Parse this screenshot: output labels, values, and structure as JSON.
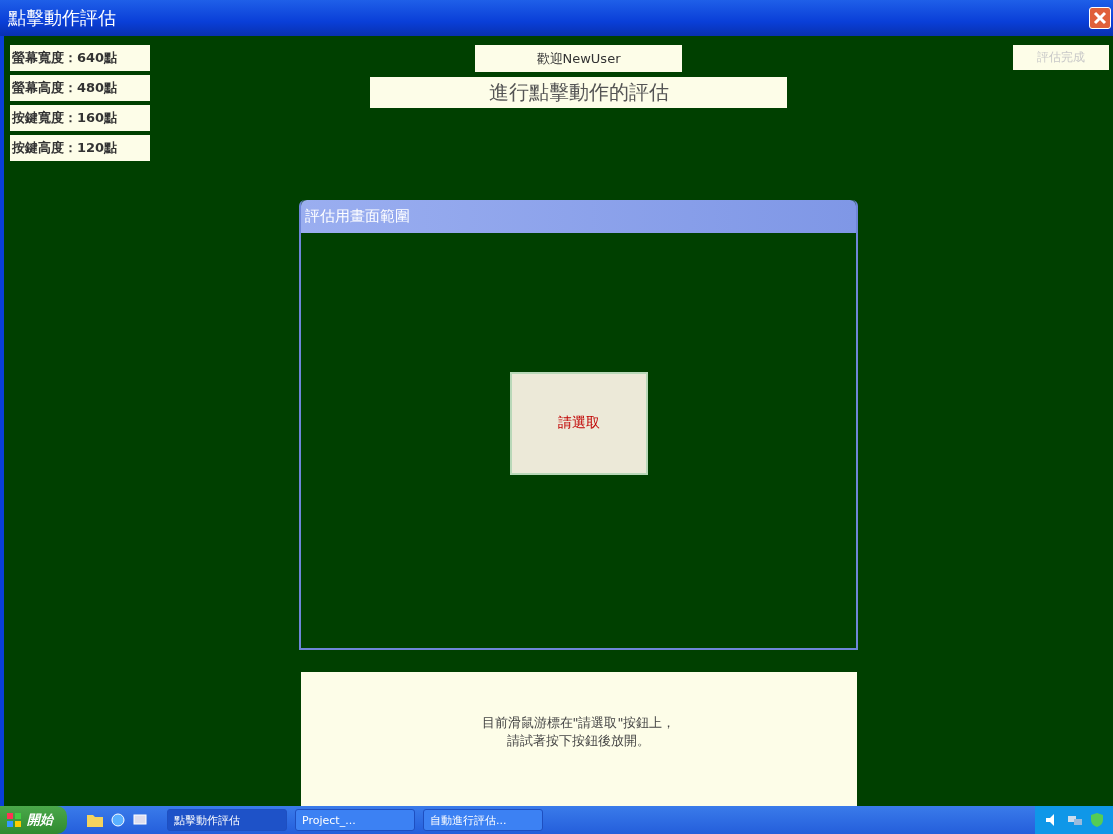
{
  "window": {
    "title": "點擊動作評估"
  },
  "settings": [
    "螢幕寬度：640點",
    "螢幕高度：480點",
    "按鍵寬度：160點",
    "按鍵高度：120點"
  ],
  "welcome": "歡迎NewUser",
  "heading": "進行點擊動作的評估",
  "finish_button": {
    "label": "評估完成",
    "disabled": true
  },
  "panel": {
    "title": "評估用畫面範圍",
    "button": "請選取"
  },
  "message": [
    "目前滑鼠游標在\"請選取\"按鈕上，",
    "請試著按下按鈕後放開。"
  ],
  "taskbar": {
    "start": "開始",
    "tasks": [
      {
        "label": "點擊動作評估",
        "selected": true
      },
      {
        "label": "Project_...",
        "selected": false
      },
      {
        "label": "自動進行評估...",
        "selected": false
      }
    ]
  }
}
